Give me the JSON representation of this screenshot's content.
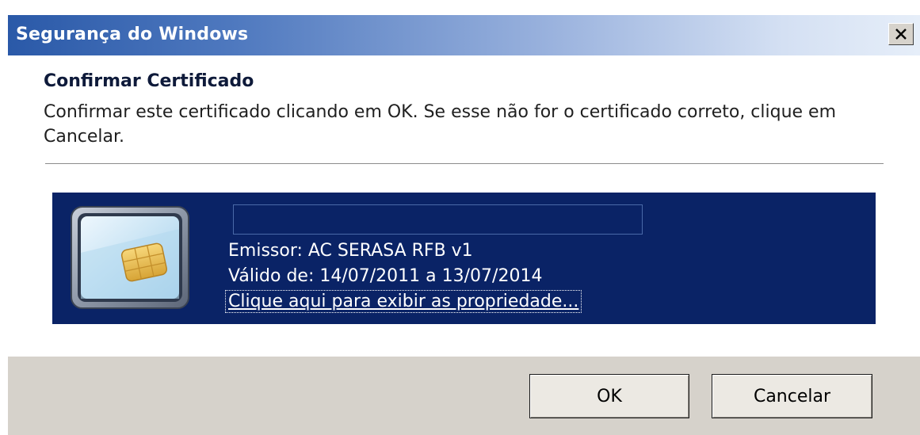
{
  "window": {
    "title": "Segurança do Windows",
    "close_glyph": "✕"
  },
  "content": {
    "heading": "Confirmar Certificado",
    "description": "Confirmar este certificado clicando em OK. Se esse não for o certificado correto, clique em Cancelar."
  },
  "certificate": {
    "issuer": "Emissor: AC SERASA RFB v1",
    "validity": "Válido de: 14/07/2011 a 13/07/2014",
    "properties_link": "Clique aqui para exibir as propriedade...",
    "icon": "smart-card-icon"
  },
  "buttons": {
    "ok": "OK",
    "cancel": "Cancelar"
  },
  "colors": {
    "panel_bg": "#0a2366",
    "title_start": "#2a59a8",
    "footer_bg": "#d6d2cb"
  }
}
